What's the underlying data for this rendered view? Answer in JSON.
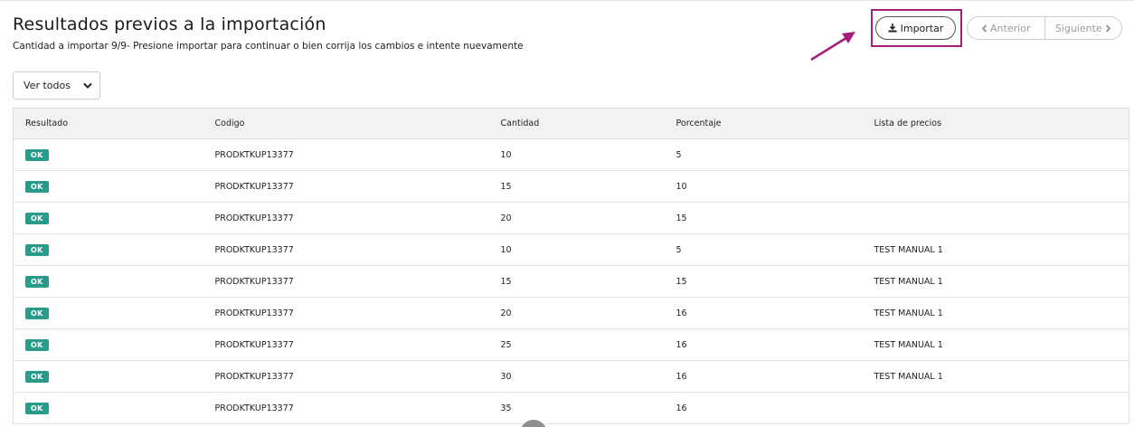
{
  "header": {
    "title": "Resultados previos a la importación",
    "subtitle": "Cantidad a importar 9/9- Presione importar para continuar o bien corrija los cambios e intente nuevamente"
  },
  "toolbar": {
    "import_label": "Importar",
    "prev_label": "Anterior",
    "next_label": "Siguiente"
  },
  "filter": {
    "selected": "Ver todos"
  },
  "colors": {
    "accent": "#a21f7a",
    "ok_badge": "#2a9a8a"
  },
  "table": {
    "columns": [
      "Resultado",
      "Codigo",
      "Cantidad",
      "Porcentaje",
      "Lista de precios"
    ],
    "rows": [
      [
        "OK",
        "PRODKTKUP13377",
        "10",
        "5",
        ""
      ],
      [
        "OK",
        "PRODKTKUP13377",
        "15",
        "10",
        ""
      ],
      [
        "OK",
        "PRODKTKUP13377",
        "20",
        "15",
        ""
      ],
      [
        "OK",
        "PRODKTKUP13377",
        "10",
        "5",
        "TEST MANUAL 1"
      ],
      [
        "OK",
        "PRODKTKUP13377",
        "15",
        "15",
        "TEST MANUAL 1"
      ],
      [
        "OK",
        "PRODKTKUP13377",
        "20",
        "16",
        "TEST MANUAL 1"
      ],
      [
        "OK",
        "PRODKTKUP13377",
        "25",
        "16",
        "TEST MANUAL 1"
      ],
      [
        "OK",
        "PRODKTKUP13377",
        "30",
        "16",
        "TEST MANUAL 1"
      ],
      [
        "OK",
        "PRODKTKUP13377",
        "35",
        "16",
        ""
      ]
    ]
  }
}
